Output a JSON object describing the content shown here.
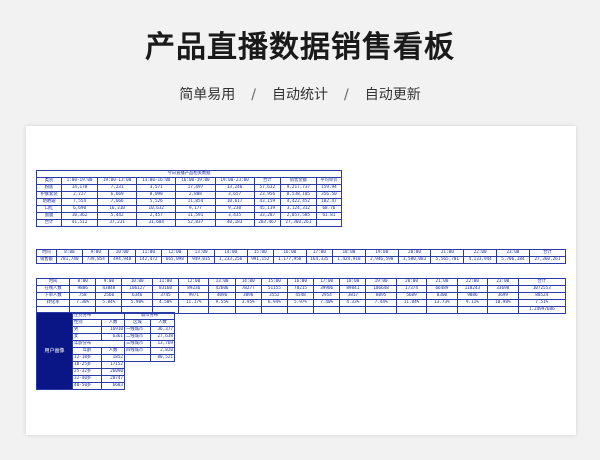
{
  "header": {
    "title": "产品直播数据销售看板",
    "features": [
      "简单易用",
      "自动统计",
      "自动更新"
    ],
    "separator": "/"
  },
  "table_product": {
    "caption": "今日直播产品相关数据",
    "headers": [
      "类别",
      "1:00-19:00",
      "19:00-13:00",
      "13:00-16:00",
      "16:00-19:00",
      "19:00-23:00",
      "合计",
      "销售金额",
      "平均单价"
    ],
    "rows": [
      [
        "粉底",
        "14,178",
        "7,231",
        "3,571",
        "17,497",
        "13,246",
        "57,632",
        "9,217,737",
        "159.94"
      ],
      [
        "护肤套装",
        "2,727",
        "6,669",
        "8,098",
        "2,808",
        "3,657",
        "23,956",
        "8,538,185",
        "356.50"
      ],
      [
        "防晒霜",
        "7,554",
        "7,666",
        "5,526",
        "11,854",
        "10,617",
        "43,159",
        "4,422,452",
        "102.47"
      ],
      [
        "口红",
        "6,690",
        "16,310",
        "10,632",
        "9,177",
        "9,230",
        "45,139",
        "3,124,312",
        "68.76"
      ],
      [
        "面膜",
        "10,362",
        "5,442",
        "2,457",
        "11,591",
        "3,435",
        "33,287",
        "2,057,585",
        "61.81"
      ],
      [
        "合计",
        "41,512",
        "37,231",
        "31,684",
        "52,837",
        "40,183",
        "203,467",
        "27,360,261",
        ""
      ]
    ]
  },
  "table_hourly_sales": {
    "headers": [
      "时间",
      "8:00",
      "9:00",
      "10:00",
      "11:00",
      "12:00",
      "13:00",
      "14:00",
      "15:00",
      "16:00",
      "17:00",
      "18:00",
      "19:00",
      "20:00",
      "21:00",
      "22:00",
      "23:00",
      "合计"
    ],
    "row": [
      "销售额",
      "781,740",
      "739,854",
      "494,948",
      "142,472",
      "665,098",
      "949,015",
      "1,233,256",
      "991,152",
      "1,177,958",
      "164,335",
      "1,424,918",
      "2,946,590",
      "3,580,083",
      "5,565,701",
      "4,133,944",
      "5,706,184",
      "27,360,261"
    ]
  },
  "table_hourly_traffic": {
    "headers": [
      "时间",
      "8:00",
      "9:00",
      "10:00",
      "11:00",
      "12:00",
      "13:00",
      "14:00",
      "15:00",
      "16:00",
      "17:00",
      "18:00",
      "19:00",
      "20:00",
      "21:00",
      "22:00",
      "23:00",
      "合计"
    ],
    "rows": [
      [
        "在线人数",
        "9886",
        "43848",
        "106127",
        "83160",
        "89236",
        "42606",
        "78277",
        "51155",
        "78215",
        "39906",
        "89841",
        "106648",
        "17374",
        "66489",
        "118243",
        "33690",
        "1072553"
      ],
      [
        "下单人数",
        "758",
        "2560",
        "6346",
        "3745",
        "9971",
        "4096",
        "3096",
        "3552",
        "4548",
        "2954",
        "3817",
        "8095",
        "5609",
        "8300",
        "9086",
        "3699",
        "80524"
      ],
      [
        "转化率",
        "7.38%",
        "5.84%",
        "5.98%",
        "4.50%",
        "11.17%",
        "9.55%",
        "3.95%",
        "6.94%",
        "5.97%",
        "7.40%",
        "4.33%",
        "7.44%",
        "11.84%",
        "13.73%",
        "9.11%",
        "10.98%",
        "7.51%"
      ],
      [
        "",
        "",
        "",
        "",
        "",
        "",
        "",
        "",
        "",
        "",
        "",
        "",
        "",
        "",
        "",
        "",
        "",
        "1.24997686"
      ]
    ]
  },
  "table_users": {
    "side_label": "用户画像",
    "gender_title": "性别分布",
    "gender_headers": [
      "性别",
      "人数"
    ],
    "gender_rows": [
      [
        "男",
        "16910"
      ],
      [
        "女",
        "6361"
      ]
    ],
    "age_title": "年龄分布",
    "age_headers": [
      "年龄",
      "人数"
    ],
    "age_rows": [
      [
        "12-18岁",
        "1852"
      ],
      [
        "18-25岁",
        "17152"
      ],
      [
        "25-32岁",
        "26090"
      ],
      [
        "32-40岁",
        "28747"
      ],
      [
        "40-50岁",
        "6683"
      ]
    ],
    "city_title": "城市分布",
    "city_headers": [
      "区域",
      "人数"
    ],
    "city_rows": [
      [
        "一线城市",
        "36,377"
      ],
      [
        "二线城市",
        "27,638"
      ],
      [
        "三线城市",
        "13,769"
      ],
      [
        "四线城市",
        "2,820"
      ],
      [
        "",
        "80,521"
      ]
    ]
  }
}
